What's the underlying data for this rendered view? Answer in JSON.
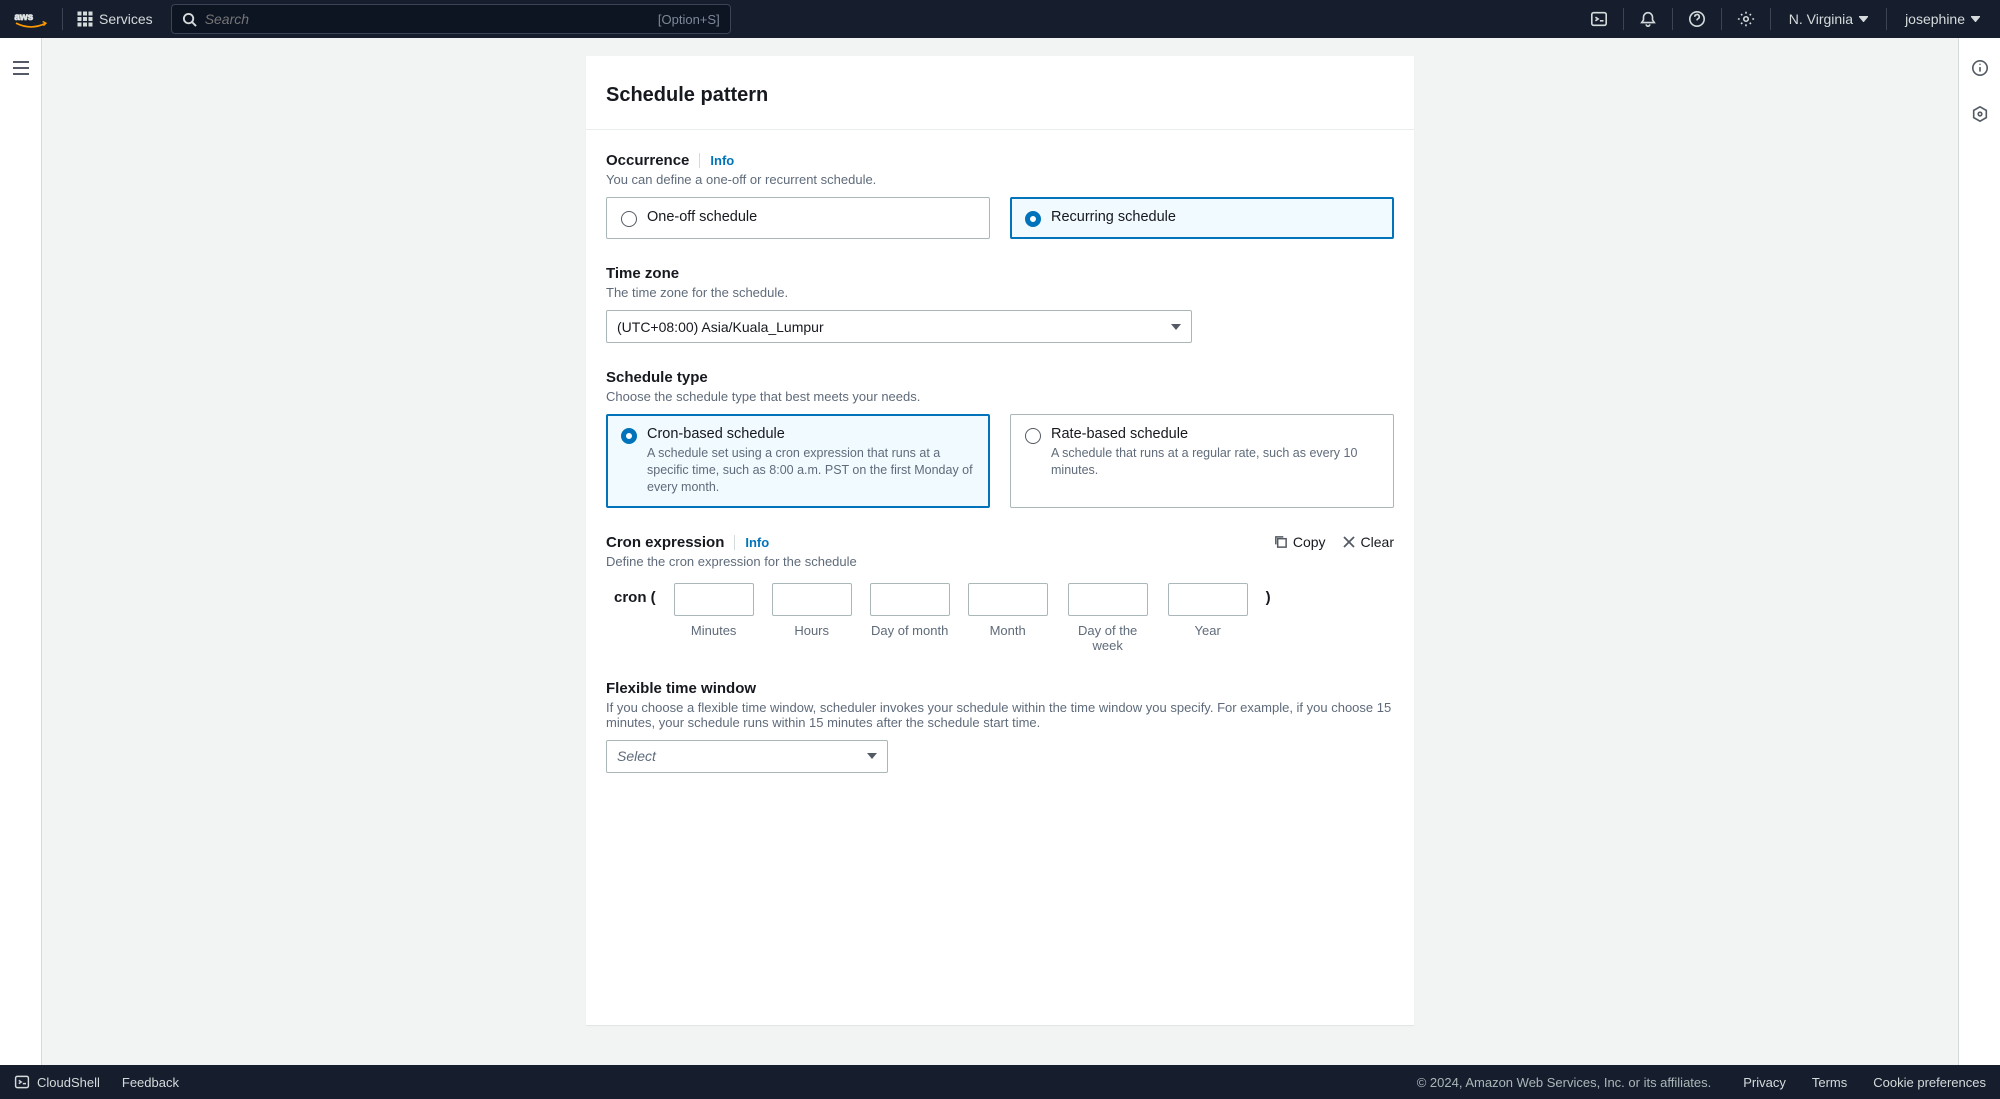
{
  "nav": {
    "services": "Services",
    "search_placeholder": "Search",
    "search_hint": "[Option+S]",
    "region": "N. Virginia",
    "user": "josephine"
  },
  "panel": {
    "title": "Schedule pattern",
    "occurrence": {
      "label": "Occurrence",
      "info": "Info",
      "desc": "You can define a one-off or recurrent schedule.",
      "one_off": "One-off schedule",
      "recurring": "Recurring schedule"
    },
    "timezone": {
      "label": "Time zone",
      "desc": "The time zone for the schedule.",
      "value": "(UTC+08:00) Asia/Kuala_Lumpur"
    },
    "schedule_type": {
      "label": "Schedule type",
      "desc": "Choose the schedule type that best meets your needs.",
      "cron_title": "Cron-based schedule",
      "cron_desc": "A schedule set using a cron expression that runs at a specific time, such as 8:00 a.m. PST on the first Monday of every month.",
      "rate_title": "Rate-based schedule",
      "rate_desc": "A schedule that runs at a regular rate, such as every 10 minutes."
    },
    "cron": {
      "label": "Cron expression",
      "info": "Info",
      "desc": "Define the cron expression for the schedule",
      "copy": "Copy",
      "clear": "Clear",
      "prefix": "cron (",
      "suffix": ")",
      "caps": {
        "minutes": "Minutes",
        "hours": "Hours",
        "dom": "Day of month",
        "month": "Month",
        "dow": "Day of the week",
        "year": "Year"
      }
    },
    "flex": {
      "label": "Flexible time window",
      "desc": "If you choose a flexible time window, scheduler invokes your schedule within the time window you specify. For example, if you choose 15 minutes, your schedule runs within 15 minutes after the schedule start time.",
      "placeholder": "Select"
    }
  },
  "footer": {
    "cloudshell": "CloudShell",
    "feedback": "Feedback",
    "copyright": "© 2024, Amazon Web Services, Inc. or its affiliates.",
    "privacy": "Privacy",
    "terms": "Terms",
    "cookies": "Cookie preferences"
  }
}
